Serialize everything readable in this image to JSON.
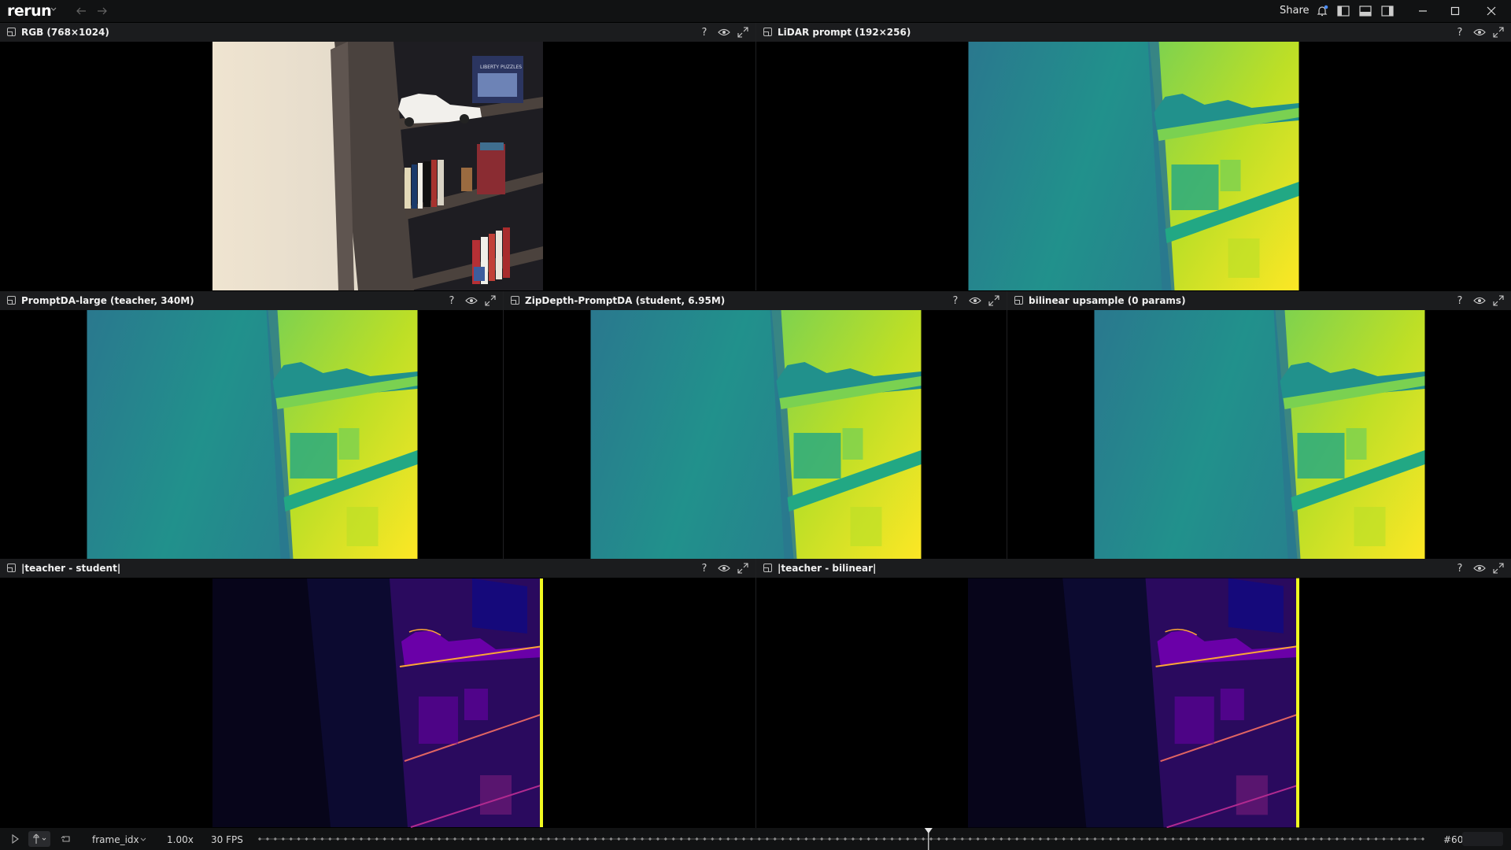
{
  "app": {
    "logo": "rerun",
    "share_label": "Share"
  },
  "panels": {
    "rgb": {
      "title": "RGB (768×1024)"
    },
    "lidar": {
      "title": "LiDAR prompt (192×256)"
    },
    "teacher": {
      "title": "PromptDA-large (teacher, 340M)"
    },
    "student": {
      "title": "ZipDepth-PromptDA (student, 6.95M)"
    },
    "bilinear": {
      "title": "bilinear upsample (0 params)"
    },
    "diff_student": {
      "title": "|teacher - student|"
    },
    "diff_bilinear": {
      "title": "|teacher - bilinear|"
    }
  },
  "panel_controls": {
    "help": "?"
  },
  "rgb_image": {
    "book_title": "LIBERTY PUZZLES",
    "colors": {
      "wall": "#e6dccb",
      "shelf": "#4f4641",
      "inside": "#1d1d22"
    }
  },
  "colormaps": {
    "depth": [
      "#2a788e",
      "#21918c",
      "#22a884",
      "#7ad151",
      "#bddf26",
      "#fde725"
    ],
    "diff": [
      "#0d0887",
      "#2a0a5e",
      "#6a00a8",
      "#b12a90",
      "#e16462",
      "#fca636",
      "#f0f921"
    ]
  },
  "timeline": {
    "timeline_name": "frame_idx",
    "speed": "1.00x",
    "fps": "30 FPS",
    "frame": "#60",
    "position_fraction": 0.575
  },
  "icons": {
    "play": "play-icon",
    "follow": "follow-icon",
    "loop": "loop-icon",
    "eye": "eye-icon",
    "maximize": "maximize-icon",
    "bell": "bell-icon"
  }
}
